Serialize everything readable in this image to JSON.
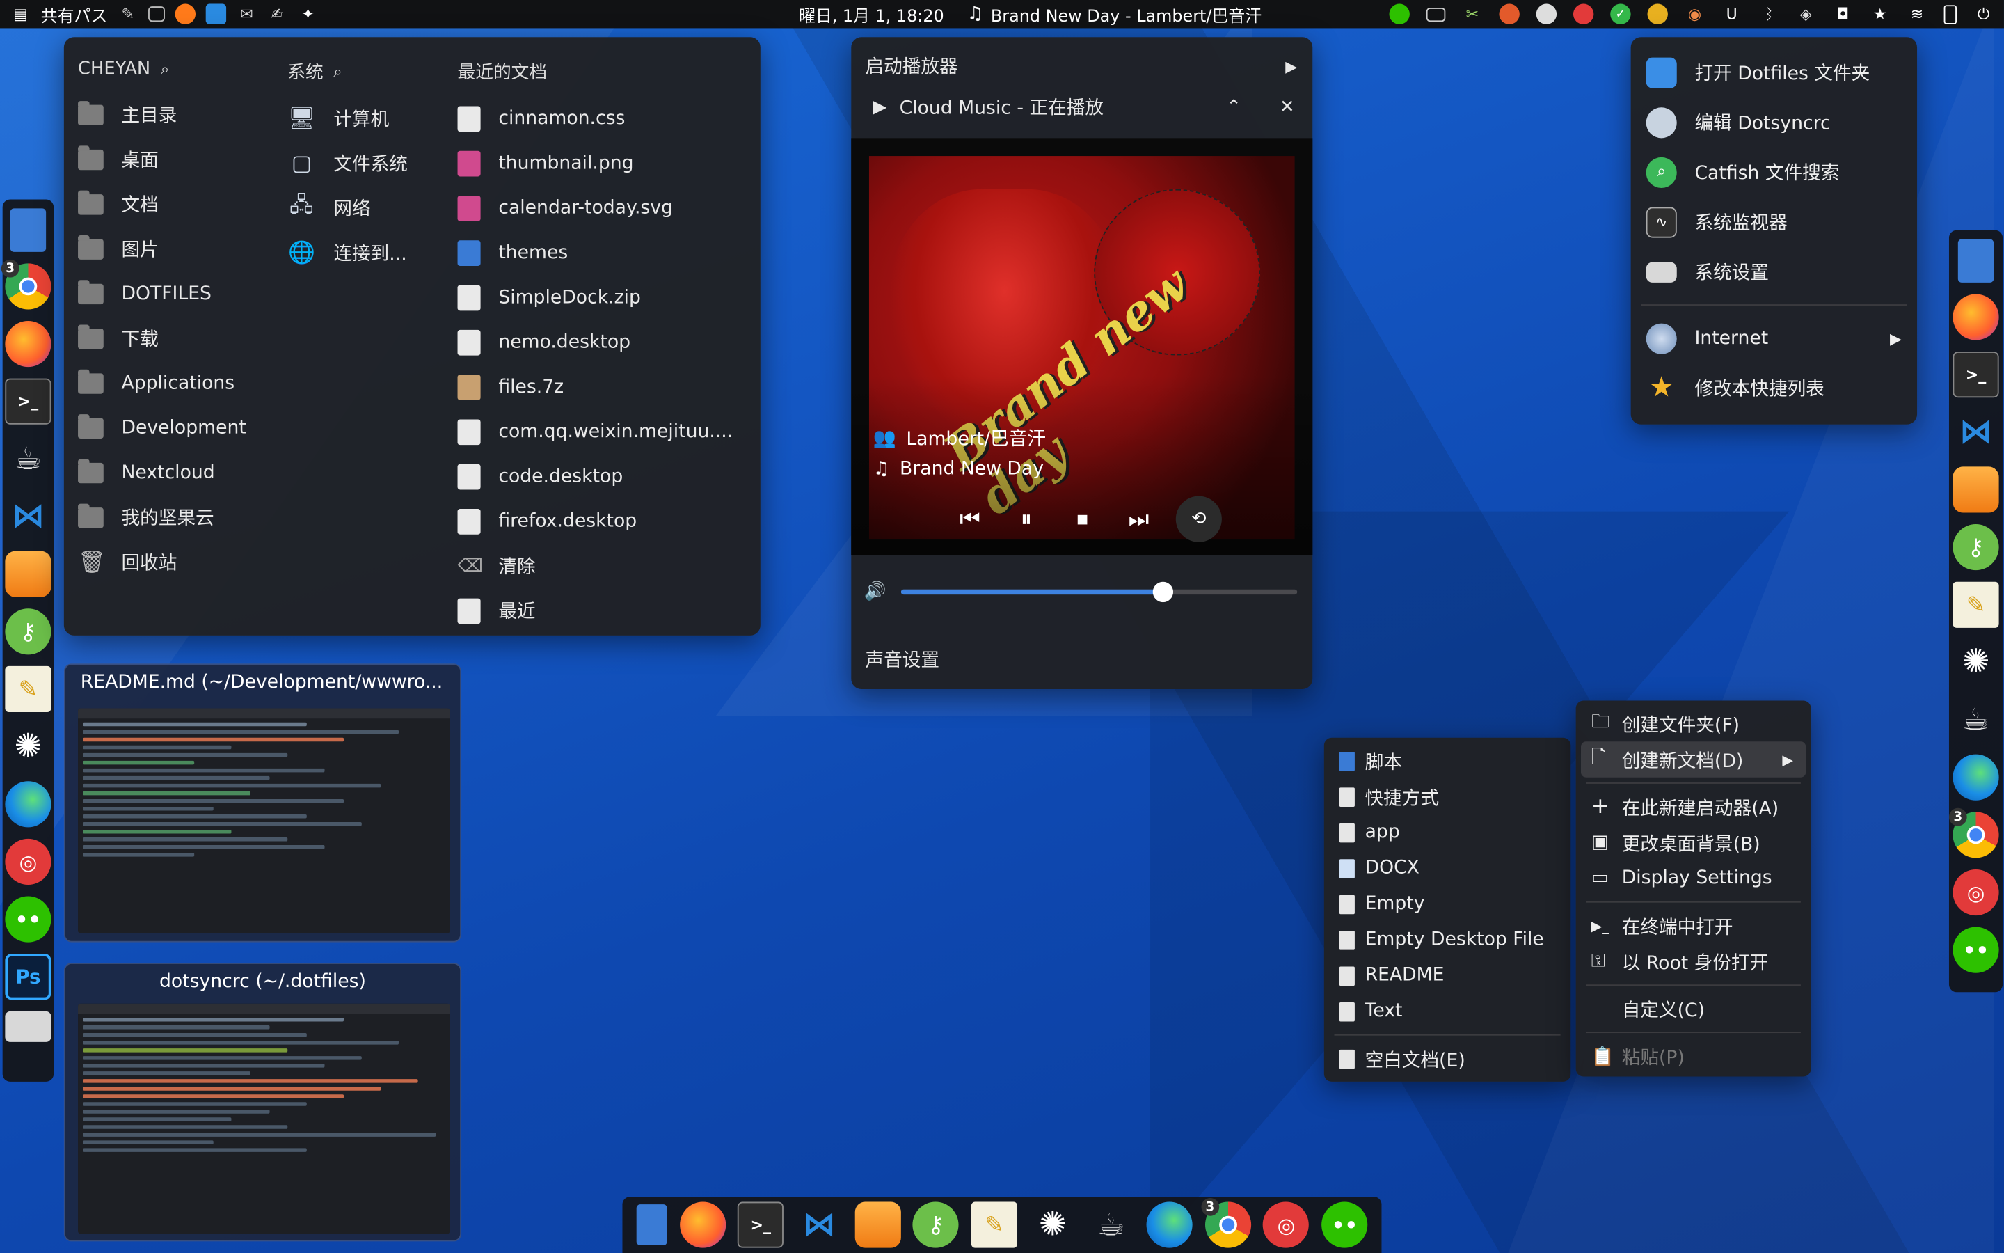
{
  "topbar": {
    "activities_label": "共有パス",
    "datetime": "曜日, 1月 1, 18:20",
    "now_playing": "Brand New Day - Lambert/巴音汗"
  },
  "places": {
    "col1_title": "CHEYAN",
    "col2_title": "系统",
    "col3_title": "最近的文档",
    "bookmarks": [
      "主目录",
      "桌面",
      "文档",
      "图片",
      "DOTFILES",
      "下载",
      "Applications",
      "Development",
      "Nextcloud",
      "我的坚果云",
      "回收站"
    ],
    "system": [
      "计算机",
      "文件系统",
      "网络",
      "连接到..."
    ],
    "recent": [
      "cinnamon.css",
      "thumbnail.png",
      "calendar-today.svg",
      "themes",
      "SimpleDock.zip",
      "nemo.desktop",
      "files.7z",
      "com.qq.weixin.mejituu....",
      "code.desktop",
      "firefox.desktop",
      "清除",
      "最近"
    ]
  },
  "sound": {
    "launch_player": "启动播放器",
    "player_name": "Cloud Music - 正在播放",
    "artist": "Lambert/巴音汗",
    "track": "Brand New Day",
    "album_art_text": "Brand new day",
    "volume_percent": 66,
    "settings_label": "声音设置"
  },
  "quicklist": {
    "items": [
      "打开 Dotfiles 文件夹",
      "编辑 Dotsyncrc",
      "Catfish 文件搜索",
      "系统监视器",
      "系统设置",
      "Internet",
      "修改本快捷列表"
    ]
  },
  "windows": {
    "readme_title": "README.md (~/Development/wwwro...",
    "dotsync_title": "dotsyncrc (~/.dotfiles)"
  },
  "desktop_menu": {
    "items": [
      "创建文件夹(F)",
      "创建新文档(D)",
      "在此新建启动器(A)",
      "更改桌面背景(B)",
      "Display Settings",
      "在终端中打开",
      "以 Root 身份打开",
      "自定义(C)",
      "粘贴(P)"
    ]
  },
  "new_doc_menu": {
    "items": [
      "脚本",
      "快捷方式",
      "app",
      "DOCX",
      "Empty",
      "Empty Desktop File",
      "README",
      "Text",
      "空白文档(E)"
    ]
  },
  "docks": {
    "left_badge": "3",
    "left_icons": [
      "files-icon",
      "chrome-icon",
      "firefox-icon",
      "terminal-icon",
      "mug-icon",
      "vscode-icon",
      "sublime-icon",
      "keepass-icon",
      "text-editor-icon",
      "chatgpt-icon",
      "edge-icon",
      "netease-music-icon",
      "wechat-icon",
      "photoshop-icon",
      "settings-icon"
    ],
    "right_badge": "3",
    "bottom_badge": "3"
  }
}
